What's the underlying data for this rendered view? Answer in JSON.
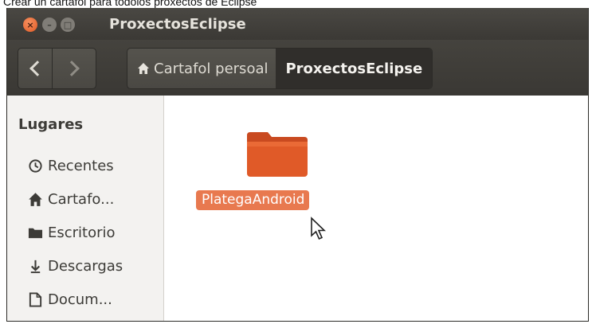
{
  "caption": "Crear un cartafol para todolos proxectos de Eclipse",
  "window": {
    "title": "ProxectosEclipse",
    "buttons": {
      "close": "×",
      "minimize": "–",
      "maximize": "□"
    }
  },
  "toolbar": {
    "breadcrumbs": [
      "Cartafol persoal",
      "ProxectosEclipse"
    ]
  },
  "sidebar": {
    "heading": "Lugares",
    "items": [
      {
        "label": "Recentes",
        "icon": "clock-icon"
      },
      {
        "label": "Cartafo...",
        "icon": "home-icon"
      },
      {
        "label": "Escritorio",
        "icon": "desktop-folder-icon"
      },
      {
        "label": "Descargas",
        "icon": "download-icon"
      },
      {
        "label": "Docum...",
        "icon": "document-icon"
      }
    ]
  },
  "main": {
    "items": [
      {
        "label": "PlategaAndroid",
        "icon": "folder-icon",
        "selected": true
      }
    ]
  },
  "colors": {
    "accent": "#e8794f",
    "folder": "#e05a28",
    "titlebar": "#3f3d39",
    "sidebar_bg": "#f3f2f0"
  }
}
